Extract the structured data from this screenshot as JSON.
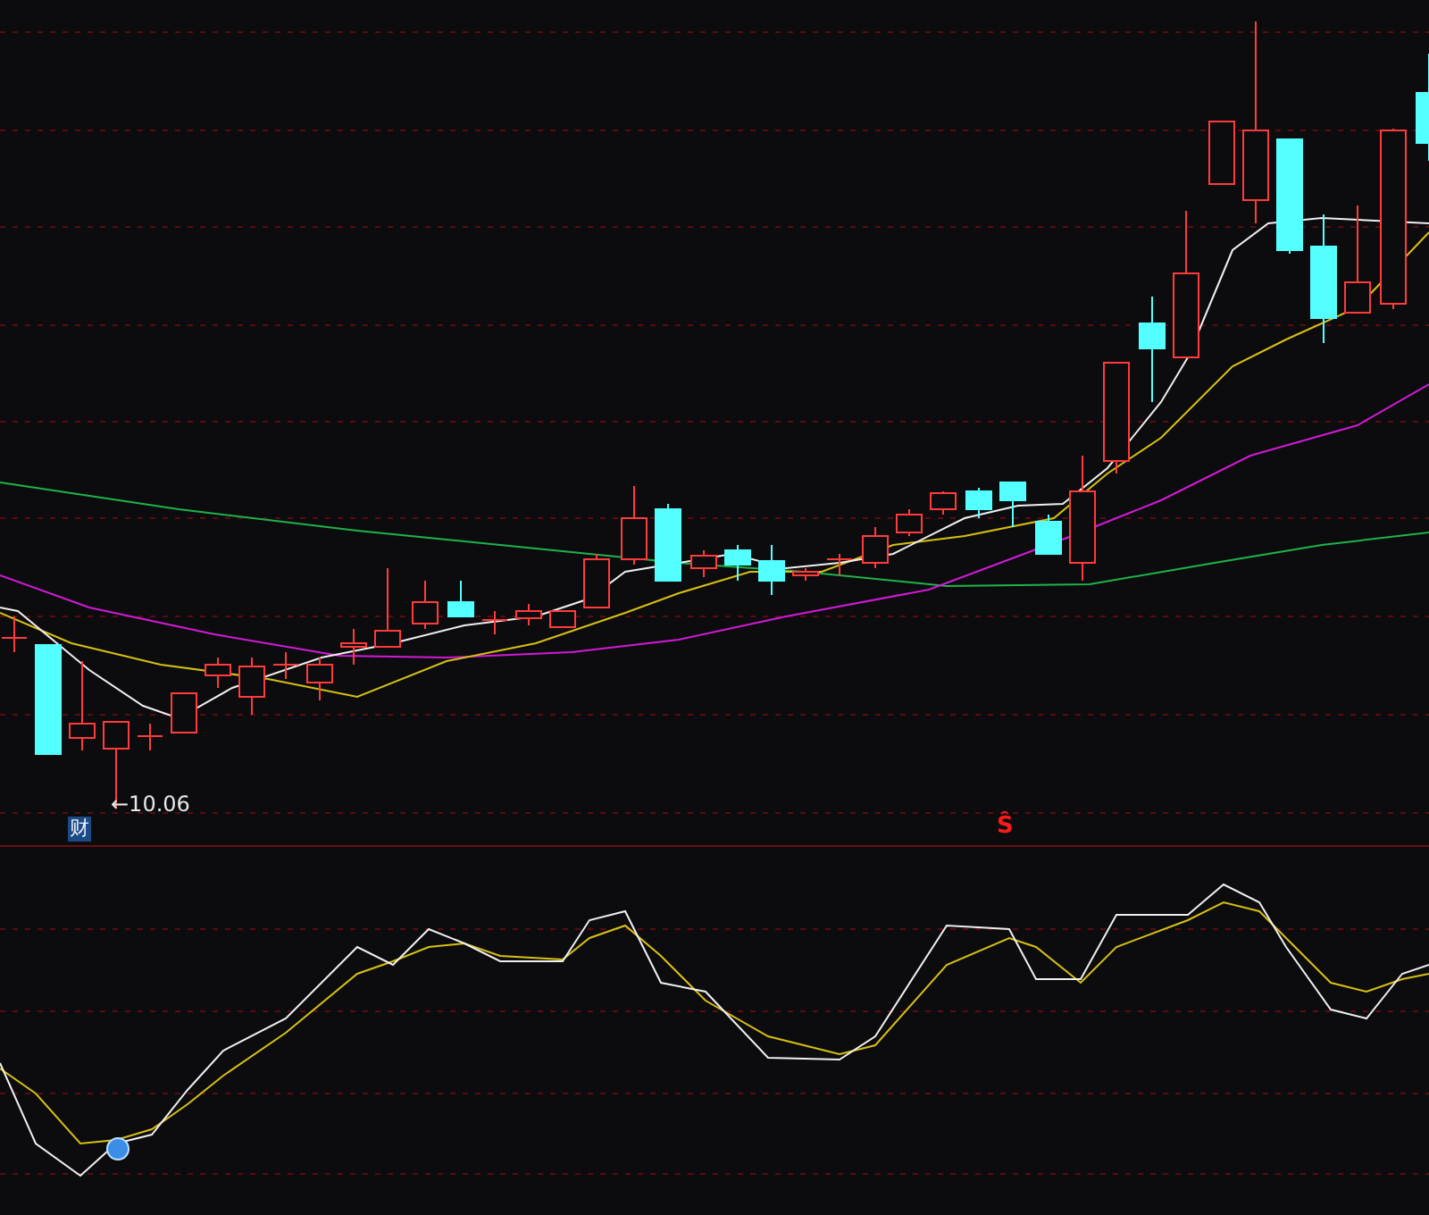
{
  "price_chart": {
    "low_marker": "←10.06",
    "event_badge": "财",
    "signal_marker": "Ŝ"
  }
}
